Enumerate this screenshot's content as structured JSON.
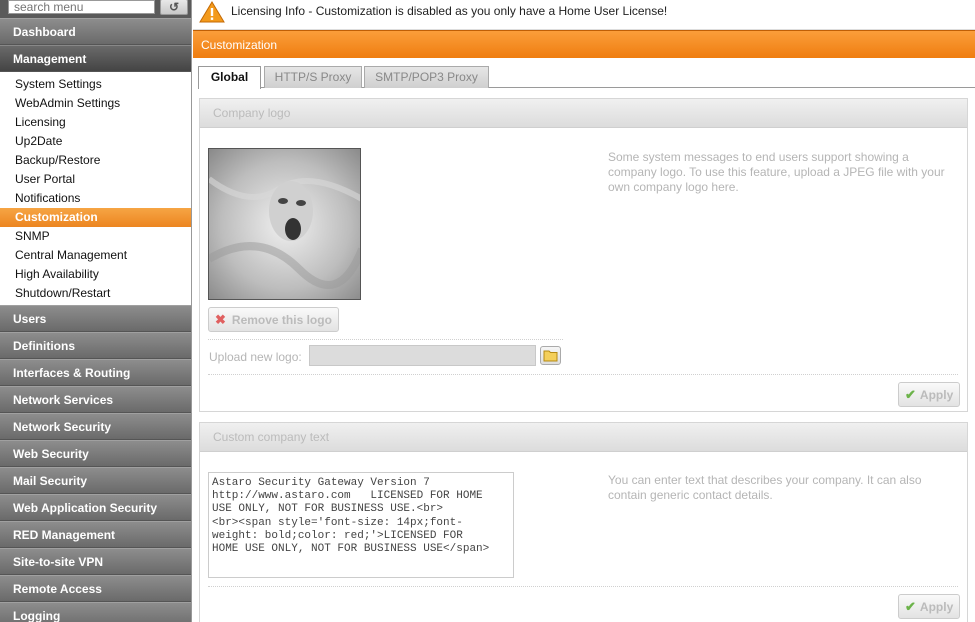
{
  "search": {
    "placeholder": "search menu",
    "reset_icon": "refresh-icon"
  },
  "sidebar": {
    "dashboard": "Dashboard",
    "management": {
      "label": "Management",
      "items": [
        "System Settings",
        "WebAdmin Settings",
        "Licensing",
        "Up2Date",
        "Backup/Restore",
        "User Portal",
        "Notifications",
        "Customization",
        "SNMP",
        "Central Management",
        "High Availability",
        "Shutdown/Restart"
      ],
      "active_item": "Customization"
    },
    "categories": [
      "Users",
      "Definitions",
      "Interfaces & Routing",
      "Network Services",
      "Network Security",
      "Web Security",
      "Mail Security",
      "Web Application Security",
      "RED Management",
      "Site-to-site VPN",
      "Remote Access",
      "Logging"
    ]
  },
  "license_bar": {
    "icon": "warning-icon",
    "text": "Licensing Info - Customization is disabled as you only have a Home User License!"
  },
  "page": {
    "title": "Customization"
  },
  "tabs": [
    "Global",
    "HTTP/S Proxy",
    "SMTP/POP3 Proxy"
  ],
  "company_logo": {
    "header": "Company logo",
    "description": "Some system messages to end users support showing a company logo. To use this feature, upload a JPEG file with your own company logo here.",
    "remove_button": "Remove this logo",
    "upload_label": "Upload new logo:",
    "folder_icon": "folder-icon",
    "apply_button": "Apply"
  },
  "company_text": {
    "header": "Custom company text",
    "value": "Astaro Security Gateway Version 7\nhttp://www.astaro.com   LICENSED FOR HOME\nUSE ONLY, NOT FOR BUSINESS USE.<br>\n<br><span style='font-size: 14px;font-\nweight: bold;color: red;'>LICENSED FOR\nHOME USE ONLY, NOT FOR BUSINESS USE</span>",
    "description": "You can enter text that describes your company. It can also contain generic contact details.",
    "apply_button": "Apply"
  },
  "colors": {
    "accent_orange": "#f08a1e",
    "sidebar_gray": "#777777",
    "disabled_text": "#b5b5b5"
  }
}
